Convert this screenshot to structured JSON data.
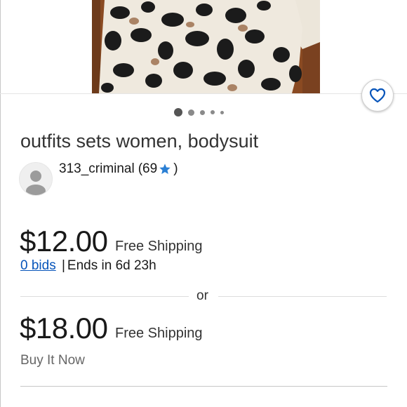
{
  "listing": {
    "title": "outfits sets women, bodysuit",
    "image_count": 5,
    "active_image_index": 0
  },
  "seller": {
    "name": "313_criminal",
    "feedback_open": "(69",
    "feedback_close": ")",
    "star_icon": "blue-star-icon"
  },
  "auction": {
    "price": "$12.00",
    "shipping": "Free Shipping",
    "bids_link": "0 bids",
    "separator": "|",
    "ends_text": "Ends in 6d 23h"
  },
  "divider": {
    "text": "or"
  },
  "buy_now": {
    "price": "$18.00",
    "shipping": "Free Shipping",
    "label": "Buy It Now"
  },
  "icons": {
    "watch": "heart-icon",
    "avatar": "person-icon"
  },
  "colors": {
    "link": "#0654ba",
    "star": "#2a7fd4",
    "heart": "#0654ba"
  }
}
